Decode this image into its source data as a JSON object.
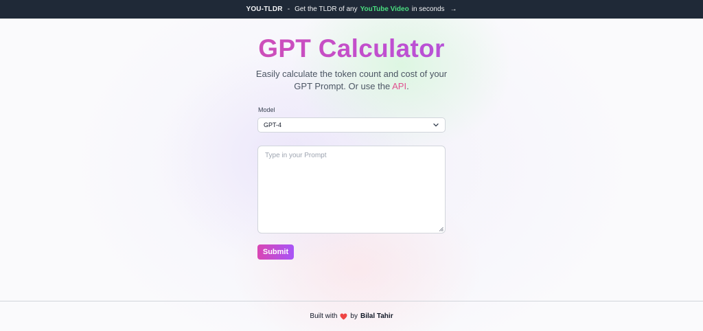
{
  "topbar": {
    "brand": "YOU-TLDR",
    "separator": "-",
    "text_before": "Get the TLDR of any",
    "highlight": "YouTube Video",
    "text_after": "in seconds",
    "arrow": "→"
  },
  "header": {
    "title": "GPT Calculator",
    "subtitle_text": "Easily calculate the token count and cost of your GPT Prompt. Or use the",
    "api_link": "API",
    "subtitle_end": "."
  },
  "form": {
    "model_label": "Model",
    "model_selected": "GPT-4",
    "prompt_placeholder": "Type in your Prompt",
    "submit_label": "Submit"
  },
  "footer": {
    "built_with": "Built with",
    "by": "by",
    "author": "Bilal Tahir"
  },
  "colors": {
    "topbar_bg": "#1f2937",
    "highlight": "#4ade80",
    "accent_pink": "#e0508e",
    "accent_purple": "#8b5cf6",
    "heart": "#ef4444"
  },
  "icons": [
    "chevron-down-icon",
    "resize-handle-icon",
    "heart-icon",
    "arrow-right-icon"
  ]
}
